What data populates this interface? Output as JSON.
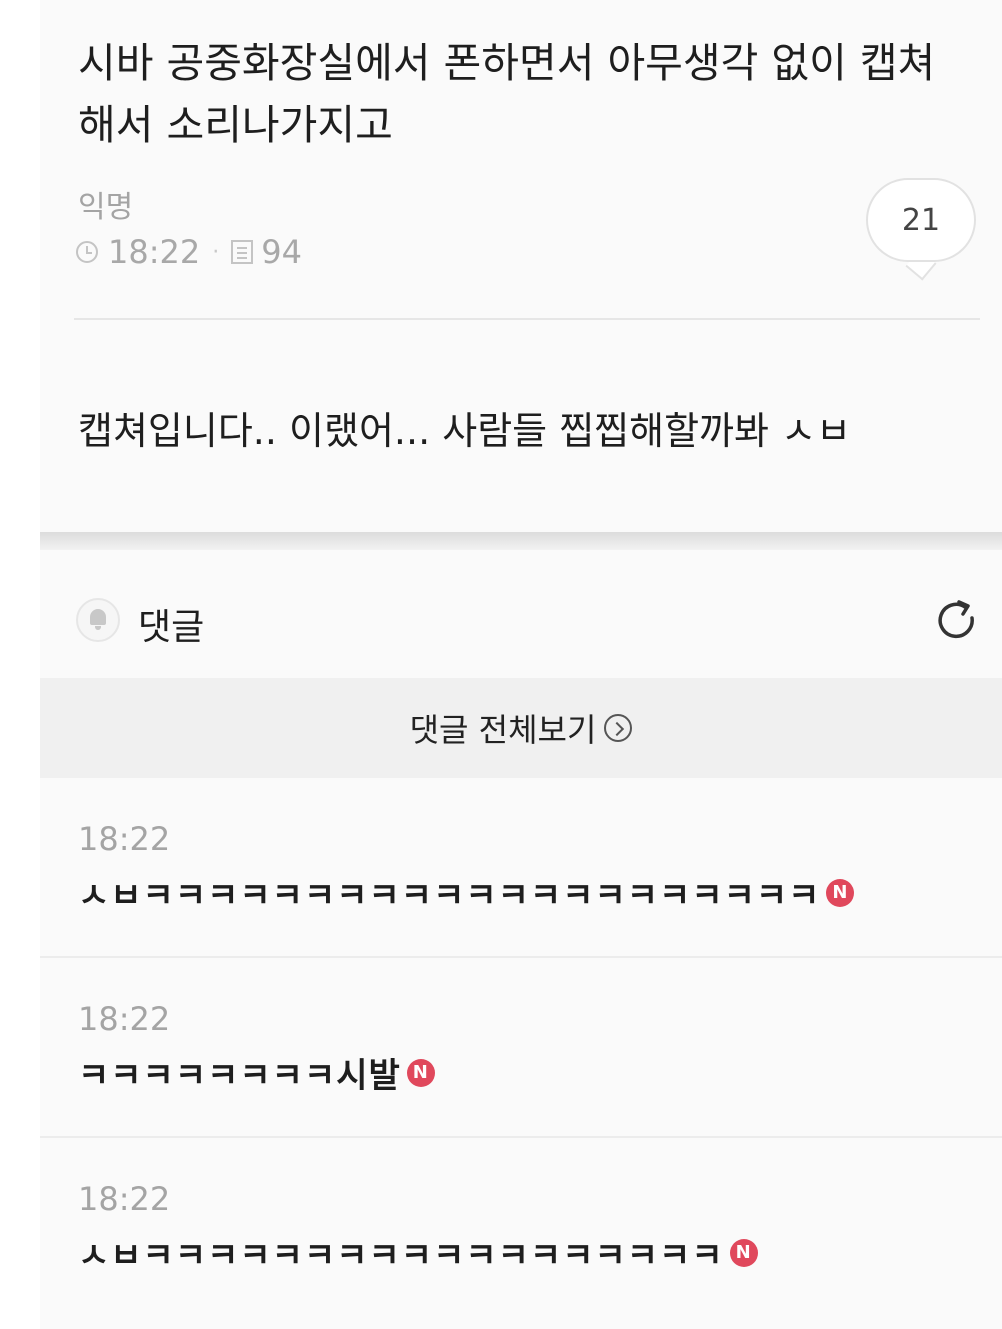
{
  "post": {
    "title": "시바 공중화장실에서 폰하면서 아무생각 없이 캡쳐해서 소리나가지고",
    "author": "익명",
    "time": "18:22",
    "views": "94",
    "comment_count": "21",
    "body": "캡쳐입니다.. 이랬어... 사람들 찝찝해할까봐 ㅅㅂ"
  },
  "comments_section": {
    "title": "댓글",
    "view_all_label": "댓글 전체보기",
    "icons": {
      "bell": "bell-icon",
      "refresh": "refresh-icon",
      "view_all": "chevron-circle-right-icon",
      "new_badge": "new-badge"
    }
  },
  "comments": [
    {
      "time": "18:22",
      "text": "ㅅㅂㅋㅋㅋㅋㅋㅋㅋㅋㅋㅋㅋㅋㅋㅋㅋㅋㅋㅋㅋㅋㅋ",
      "badge": "N"
    },
    {
      "time": "18:22",
      "text": "ㅋㅋㅋㅋㅋㅋㅋㅋ시발",
      "badge": "N"
    },
    {
      "time": "18:22",
      "text": "ㅅㅂㅋㅋㅋㅋㅋㅋㅋㅋㅋㅋㅋㅋㅋㅋㅋㅋㅋㅋ",
      "badge": "N"
    }
  ],
  "colors": {
    "badge": "#e0485c",
    "muted_text": "#a4a4a4",
    "background": "#fafafa"
  }
}
